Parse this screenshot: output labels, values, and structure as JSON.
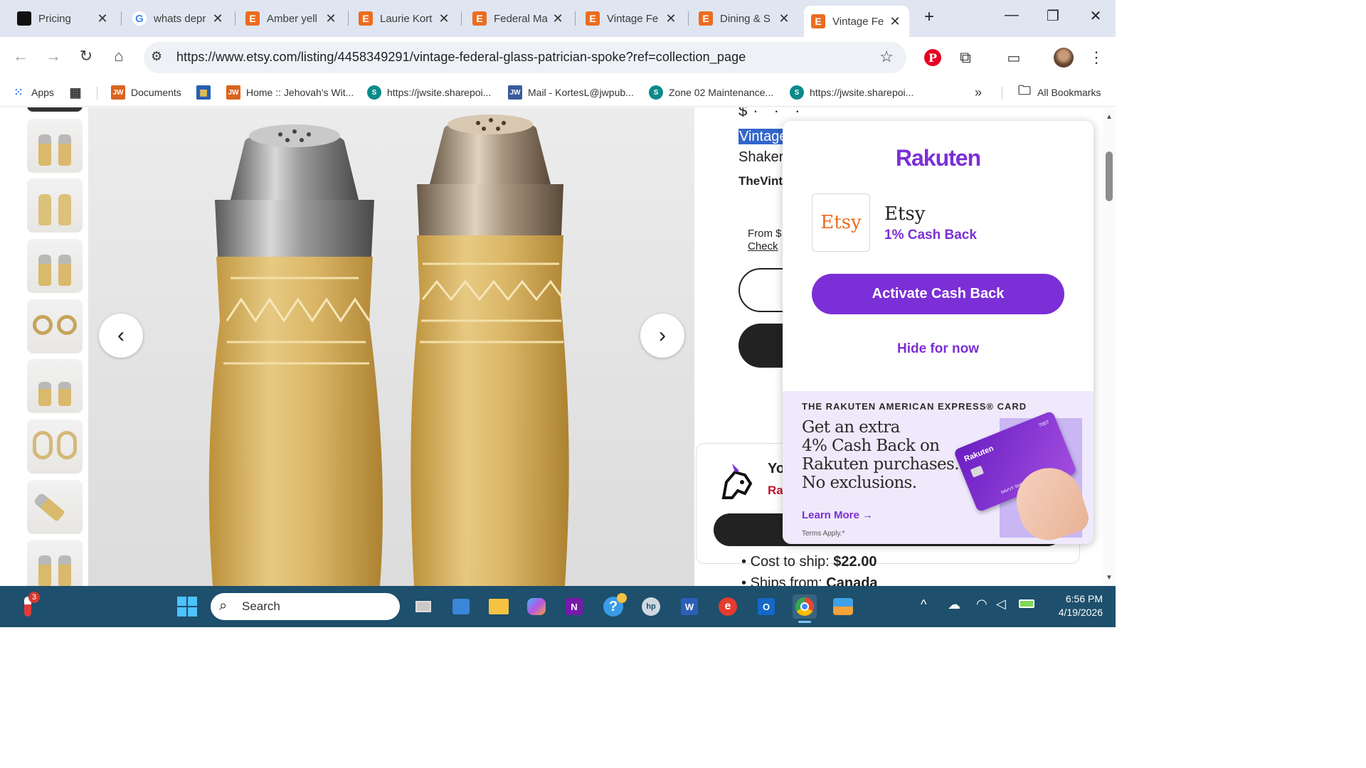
{
  "browser": {
    "tabs": [
      {
        "title": "Pricing",
        "favicon": "dark-square",
        "active": false
      },
      {
        "title": "whats depr",
        "favicon": "google-g",
        "active": false
      },
      {
        "title": "Amber yell",
        "favicon": "etsy-e",
        "active": false
      },
      {
        "title": "Laurie Kort",
        "favicon": "etsy-e",
        "active": false
      },
      {
        "title": "Federal Ma",
        "favicon": "etsy-e",
        "active": false
      },
      {
        "title": "Vintage Fe",
        "favicon": "etsy-e",
        "active": false
      },
      {
        "title": "Dining & S",
        "favicon": "etsy-e",
        "active": false
      },
      {
        "title": "Vintage Fe",
        "favicon": "etsy-e",
        "active": true
      }
    ],
    "new_tab_glyph": "+",
    "close_glyph": "✕",
    "window_controls": {
      "minimize": "—",
      "restore": "❐",
      "close": "✕"
    },
    "url": "https://www.etsy.com/listing/4458349291/vintage-federal-glass-patrician-spoke?ref=collection_page",
    "bookmarks": [
      {
        "label": "Apps",
        "icon": "apps-grid-icon"
      },
      {
        "label": "",
        "icon": "grid-icon"
      },
      {
        "label": "Documents",
        "icon": "jw-icon"
      },
      {
        "label": "",
        "icon": "ms-store-icon"
      },
      {
        "label": "Home :: Jehovah's Wit...",
        "icon": "jw-icon"
      },
      {
        "label": "https://jwsite.sharepoi...",
        "icon": "sharepoint-icon"
      },
      {
        "label": "Mail - KortesL@jwpub...",
        "icon": "jw-mail-icon"
      },
      {
        "label": "Zone 02 Maintenance...",
        "icon": "sharepoint-icon"
      },
      {
        "label": "https://jwsite.sharepoi...",
        "icon": "sharepoint-icon"
      }
    ],
    "more_bookmarks": "»",
    "all_bookmarks": "All Bookmarks"
  },
  "listing": {
    "title_highlight": "Vintage",
    "title_line2": "Shaker",
    "shop_name": "TheVint",
    "price_prefix": "From $",
    "check_link": "Check",
    "cost_to_ship_label": "Cost to ship:",
    "cost_to_ship_value": "$22.00",
    "ships_from_label": "Ships from:",
    "ships_from_value": "Canada",
    "promo_title": "Yo",
    "promo_sub": "Ra",
    "image_prev": "‹",
    "image_next": "›"
  },
  "rakuten": {
    "logo": "Rakuten",
    "merchant_logo": "Etsy",
    "merchant_name": "Etsy",
    "cashback": "1% Cash Back",
    "activate_button": "Activate Cash Back",
    "hide_link": "Hide for now",
    "card_heading": "THE RAKUTEN AMERICAN EXPRESS® CARD",
    "card_copy": [
      "Get an extra",
      "4% Cash Back on",
      "Rakuten purchases.",
      "No exclusions."
    ],
    "learn_more": "Learn More",
    "terms": "Terms Apply.*",
    "card_brand": "Rakuten",
    "card_digits": "7007",
    "card_holder": "SAVVY SHOPPER",
    "colors": {
      "purple": "#7b2fd6",
      "card_panel": "#efe9fb"
    }
  },
  "taskbar": {
    "search_placeholder": "Search",
    "weather_badge": "3",
    "time": "6:56 PM",
    "date": "4/19/2026",
    "tray_expand": "^"
  }
}
